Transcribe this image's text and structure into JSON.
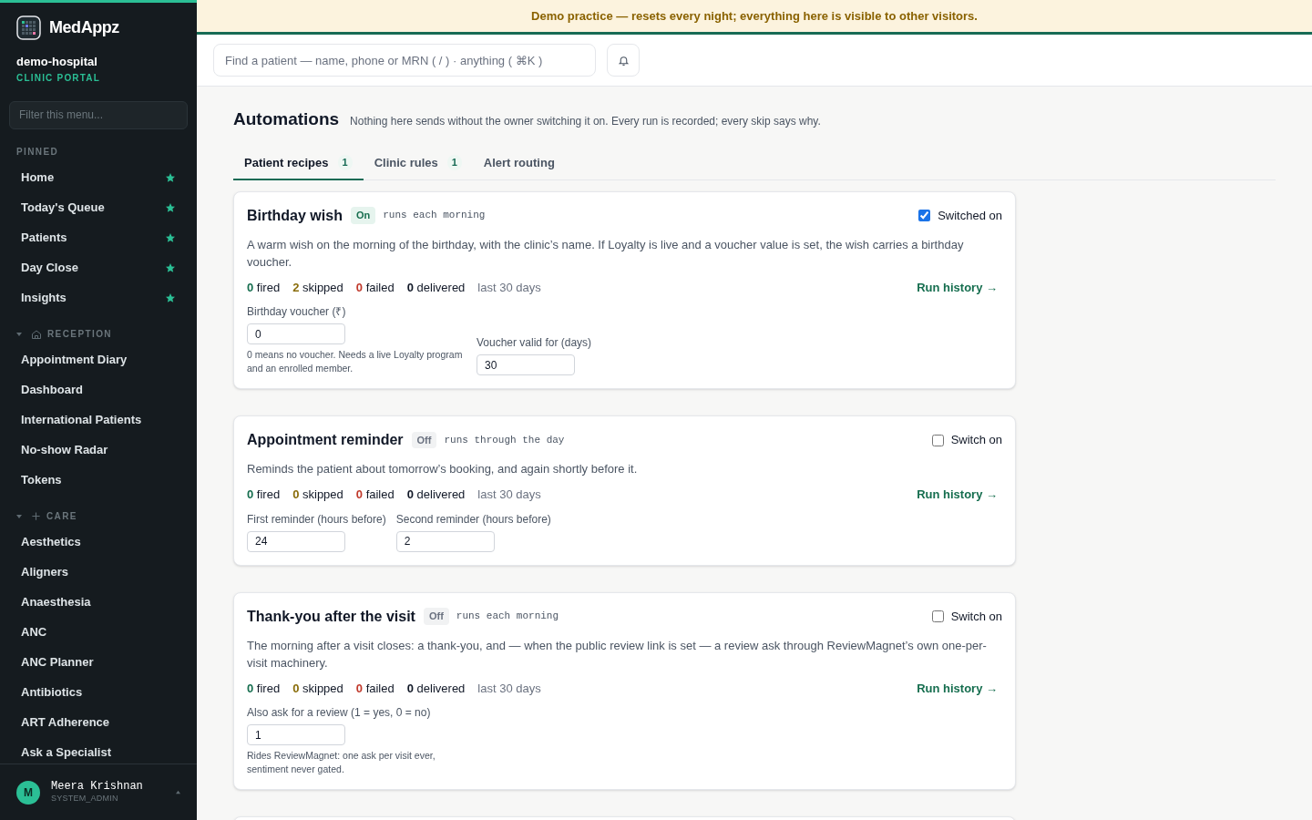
{
  "brand": {
    "name": "MedAppz",
    "org": "demo-hospital",
    "portal": "CLINIC PORTAL"
  },
  "sidebar": {
    "filter_placeholder": "Filter this menu...",
    "sections": [
      {
        "kind": "pinned",
        "title": "PINNED",
        "items": [
          {
            "label": "Home",
            "pinned": true
          },
          {
            "label": "Today's Queue",
            "pinned": true
          },
          {
            "label": "Patients",
            "pinned": true
          },
          {
            "label": "Day Close",
            "pinned": true
          },
          {
            "label": "Insights",
            "pinned": true
          }
        ]
      },
      {
        "kind": "reception",
        "title": "RECEPTION",
        "expanded": true,
        "items": [
          {
            "label": "Appointment Diary",
            "pinned": false
          },
          {
            "label": "Dashboard",
            "pinned": false
          },
          {
            "label": "International Patients",
            "pinned": false
          },
          {
            "label": "No-show Radar",
            "pinned": false
          },
          {
            "label": "Tokens",
            "pinned": false
          }
        ]
      },
      {
        "kind": "care",
        "title": "CARE",
        "expanded": true,
        "items": [
          {
            "label": "Aesthetics",
            "pinned": false
          },
          {
            "label": "Aligners",
            "pinned": false
          },
          {
            "label": "Anaesthesia",
            "pinned": false
          },
          {
            "label": "ANC",
            "pinned": false
          },
          {
            "label": "ANC Planner",
            "pinned": false
          },
          {
            "label": "Antibiotics",
            "pinned": false
          },
          {
            "label": "ART Adherence",
            "pinned": false
          },
          {
            "label": "Ask a Specialist",
            "pinned": false
          }
        ]
      }
    ],
    "user": {
      "initial": "M",
      "name": "Meera Krishnan",
      "role": "SYSTEM_ADMIN"
    }
  },
  "banner": "Demo practice — resets every night; everything here is visible to other visitors.",
  "search": {
    "placeholder": "Find a patient — name, phone or MRN ( / ) · anything ( ⌘K )"
  },
  "page": {
    "title": "Automations",
    "subtitle": "Nothing here sends without the owner switching it on. Every run is recorded; every skip says why."
  },
  "tabs": [
    {
      "label": "Patient recipes",
      "count": "1",
      "selected": true
    },
    {
      "label": "Clinic rules",
      "count": "1",
      "selected": false
    },
    {
      "label": "Alert routing",
      "selected": false
    }
  ],
  "cards": [
    {
      "title": "Birthday wish",
      "status": "On",
      "on": true,
      "schedule": "runs each morning",
      "switch_label": "Switched on",
      "description": "A warm wish on the morning of the birthday, with the clinic’s name. If Loyalty is live and a voucher value is set, the wish carries a birthday voucher.",
      "stats": [
        {
          "kind": "fired",
          "text": "0 fired"
        },
        {
          "kind": "skipped",
          "text": "2 skipped"
        },
        {
          "kind": "failed",
          "text": "0 failed"
        },
        {
          "kind": "delivered",
          "text": "0 delivered"
        }
      ],
      "period": "last 30 days",
      "history_link": "Run history →",
      "fields": [
        {
          "label": "Birthday voucher (₹)",
          "value": "0",
          "hint": "0 means no voucher. Needs a live Loyalty program and an enrolled member."
        },
        {
          "label": "Voucher valid for (days)",
          "value": "30"
        }
      ]
    },
    {
      "title": "Appointment reminder",
      "status": "Off",
      "on": false,
      "schedule": "runs through the day",
      "switch_label": "Switch on",
      "description": "Reminds the patient about tomorrow’s booking, and again shortly before it.",
      "stats": [
        {
          "kind": "fired",
          "text": "0 fired"
        },
        {
          "kind": "skipped",
          "text": "0 skipped"
        },
        {
          "kind": "failed",
          "text": "0 failed"
        },
        {
          "kind": "delivered",
          "text": "0 delivered"
        }
      ],
      "period": "last 30 days",
      "history_link": "Run history →",
      "fields": [
        {
          "label": "First reminder (hours before)",
          "value": "24"
        },
        {
          "label": "Second reminder (hours before)",
          "value": "2"
        }
      ]
    },
    {
      "title": "Thank-you after the visit",
      "status": "Off",
      "on": false,
      "schedule": "runs each morning",
      "switch_label": "Switch on",
      "description": "The morning after a visit closes: a thank-you, and — when the public review link is set — a review ask through ReviewMagnet’s own one-per-visit machinery.",
      "stats": [
        {
          "kind": "fired",
          "text": "0 fired"
        },
        {
          "kind": "skipped",
          "text": "0 skipped"
        },
        {
          "kind": "failed",
          "text": "0 failed"
        },
        {
          "kind": "delivered",
          "text": "0 delivered"
        }
      ],
      "period": "last 30 days",
      "history_link": "Run history →",
      "fields": [
        {
          "label": "Also ask for a review (1 = yes, 0 = no)",
          "value": "1",
          "hint": "Rides ReviewMagnet: one ask per visit ever, sentiment never gated."
        }
      ]
    }
  ]
}
